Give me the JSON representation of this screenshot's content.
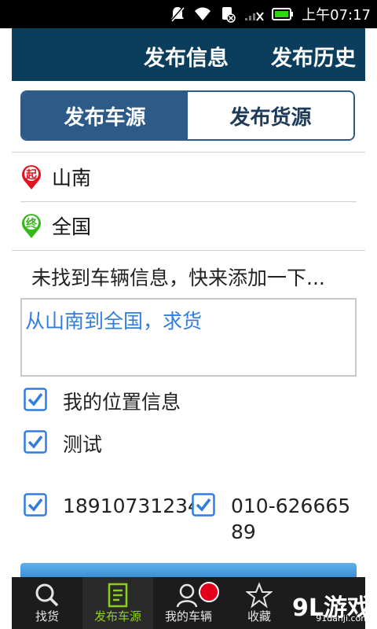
{
  "status_bar": {
    "time": "上午07:17"
  },
  "header": {
    "title": "发布信息",
    "history_button": "发布历史"
  },
  "segment": {
    "tabs": [
      {
        "label": "发布车源",
        "active": true
      },
      {
        "label": "发布货源",
        "active": false
      }
    ]
  },
  "origin": {
    "badge": "起",
    "value": "山南"
  },
  "destination": {
    "badge": "终",
    "value": "全国"
  },
  "notice": "未找到车辆信息，快来添加一下...",
  "message": {
    "value": "从山南到全国，求货"
  },
  "options": [
    {
      "label": "我的位置信息",
      "checked": true
    },
    {
      "label": "测试",
      "checked": true
    }
  ],
  "phones": [
    {
      "number": "18910731234",
      "checked": true
    },
    {
      "number": "010-62666589",
      "checked": true
    }
  ],
  "bottom_nav": {
    "items": [
      {
        "label": "找货",
        "icon": "search-icon",
        "active": false
      },
      {
        "label": "发布车源",
        "icon": "document-icon",
        "active": true
      },
      {
        "label": "我的车辆",
        "icon": "person-icon",
        "active": false
      },
      {
        "label": "收藏",
        "icon": "star-icon",
        "active": false
      }
    ]
  },
  "watermark": {
    "logo": "9L游戏",
    "url": "91danji.com"
  },
  "colors": {
    "header_bg": "#0b3d5d",
    "segment_active": "#2d5a86",
    "link_blue": "#2f7de0",
    "nav_active": "#8bd11c",
    "check_blue": "#2f7de0"
  }
}
